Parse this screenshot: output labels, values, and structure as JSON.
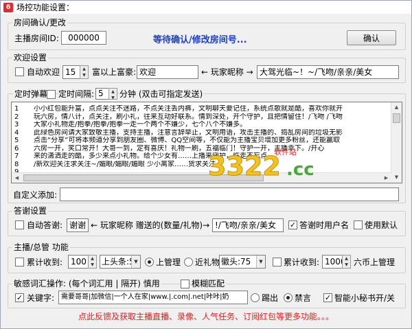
{
  "window": {
    "title": "场控功能设置："
  },
  "room": {
    "group_title": "房间确认/更改",
    "id_label": "主播房间ID:",
    "id_value": "000000",
    "status": "等待确认/修改房间号...",
    "confirm_button": "确认"
  },
  "welcome": {
    "group_title": "欢迎设置",
    "auto_welcome_label": "自动欢迎",
    "auto_welcome_checked": false,
    "level_value": "15",
    "rich_label": "富以上富豪:",
    "welcome_text": "欢迎",
    "arrow_text": "← 玩家昵称 →",
    "greeting_text": "大驾光临~！~/飞吻/亲亲/美女"
  },
  "barrage": {
    "timed_label": "定时弹幕",
    "interval_checked": false,
    "interval_label": "定时间隔:",
    "interval_value": "5",
    "interval_unit": "分钟 (双击可指定发送)",
    "lines": [
      {
        "n": "1",
        "text": "小小红包能升富，点点关注不迷路，不点关注丢内裤，文明聊天要记住，系统点歌就是酷，喜欢你就开"
      },
      {
        "n": "2",
        "text": "玩六房，情八计，点关注，刷小礼，往来互动好联系。情到深处，开个守护，且把情留住！/飞吻 /飞吻"
      },
      {
        "n": "3",
        "text": "大家小礼物走/抱拳/抱拳/抱拳一走一个两个不嫌少，七个八个不嫌多。"
      },
      {
        "n": "4",
        "text": "此绿色房间请大家致敬主播，支持主播，注意言辞举止，文明用语，攻击主播的、捣乱房间的垃圾无影"
      },
      {
        "n": "5",
        "text": "点击“分享”可将本频道分享到朋友圈、微博、QQ空间等，不仅能为主播宝贝增加更多粉丝，还能赢取"
      },
      {
        "n": "6",
        "text": "六房一开，笑口常开！大哥一到，定有喜庆！礼物一刷，五福临门！守护一开，主播幸下。/开心"
      },
      {
        "n": "7",
        "text": "来的潇洒走的酷，多少来点小礼物。给个少女有……上播来守护，临走不忘点"
      },
      {
        "n": "8",
        "text": "/新欢迎关注求关注~/媚眼/媚眼/媚眼 少小离家……货求关注"
      },
      {
        "n": "9",
        "text": "……"
      }
    ]
  },
  "custom": {
    "label": "自定义添加:",
    "value": ""
  },
  "thanks": {
    "group_title": "答谢设置",
    "auto_thanks_label": "自动答谢:",
    "auto_thanks_checked": false,
    "thanks_text": "谢谢",
    "arrow_text": "← 玩家昵称 赠送的(数量/礼物)→",
    "after_text": "!/飞吻/亲亲/美女",
    "use_name_label": "答谢时用户名",
    "use_name_checked": true,
    "default_label": "使用默认",
    "default_checked": false
  },
  "admin": {
    "group_title": "主播/总管 功能",
    "accum_label": "累计收到:",
    "accum_checked": false,
    "accum_value": "100",
    "upper_combo": "上头条:5",
    "upper_admin_label": "上管理",
    "upper_admin_selected": true,
    "near_gift_label": "近礼物",
    "near_gift_selected": false,
    "medal_combo": "徽头:75",
    "accum2_label": "累计收到:",
    "accum2_checked": false,
    "accum2_value": "1000",
    "accum2_suffix": "六币上管理"
  },
  "sensitive": {
    "group_title": "敏感词汇操作: (每个词汇用 | 隔开) 慎用",
    "fuzzy_label": "模糊匹配",
    "fuzzy_checked": false,
    "keyword_label": "关键字:",
    "keyword_checked": true,
    "keywords": "需要哥哥|加微信|一个人在家|www.|.com|.net|咔咔|奶",
    "kick_label": "踢出",
    "kick_selected": false,
    "mute_label": "禁言",
    "mute_selected": true,
    "smart_label": "智能小秘书开/关",
    "smart_checked": true
  },
  "promo": "点此反馈及获取主播直播、录像、人气任务、订阅红包等更多功能。。。",
  "watermark": {
    "text": "3322.cc",
    "sub": "软件站"
  },
  "colors": {
    "status_blue": "#1a3fc8",
    "promo_red": "#e02020",
    "title_icon": "#e8262b"
  }
}
